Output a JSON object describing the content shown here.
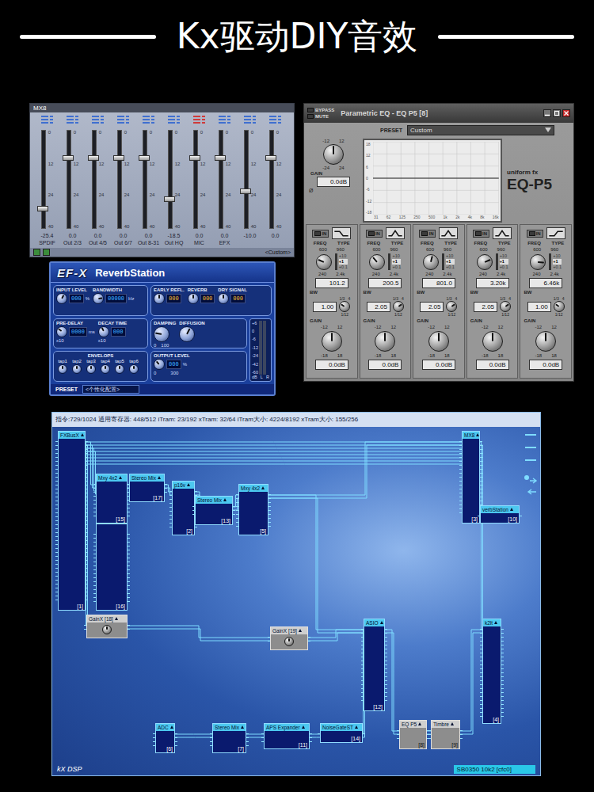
{
  "banner": {
    "title": "Kx驱动DIY音效"
  },
  "mixer": {
    "title": "MX8",
    "scale": [
      "0",
      "12",
      "24",
      "40"
    ],
    "preset": "<Custom>",
    "channels": [
      {
        "name": "SPDIF",
        "reading": "-25.4",
        "level": 0.2,
        "color": "#3f6fd0"
      },
      {
        "name": "Out 2/3",
        "reading": "0.0",
        "level": 0.72,
        "color": "#3f6fd0"
      },
      {
        "name": "Out 4/5",
        "reading": "0.0",
        "level": 0.72,
        "color": "#3f6fd0"
      },
      {
        "name": "Out 6/7",
        "reading": "0.0",
        "level": 0.72,
        "color": "#3f6fd0"
      },
      {
        "name": "Out 8-31",
        "reading": "0.0",
        "level": 0.72,
        "color": "#3f6fd0"
      },
      {
        "name": "Out HQ",
        "reading": "-18.5",
        "level": 0.3,
        "color": "#3f6fd0"
      },
      {
        "name": "MIC",
        "reading": "0.0",
        "level": 0.72,
        "color": "#d03a3a"
      },
      {
        "name": "EFX",
        "reading": "0.0",
        "level": 0.72,
        "color": "#3f6fd0"
      },
      {
        "name": "",
        "reading": "-10.0",
        "level": 0.38,
        "color": "#3f6fd0"
      },
      {
        "name": "",
        "reading": "0.0",
        "level": 0.72,
        "color": "#3f6fd0"
      }
    ]
  },
  "reverb": {
    "logo": "EF-X",
    "title": "ReverbStation",
    "input": [
      {
        "label": "INPUT LEVEL",
        "value": "000",
        "unit": "%",
        "level": 0.6
      },
      {
        "label": "BANDWIDTH",
        "value": "00000",
        "unit": "Hz",
        "level": 0.8
      }
    ],
    "levels": [
      {
        "label": "EARLY REFL.",
        "value": "000",
        "level": 0.5
      },
      {
        "label": "REVERB",
        "value": "000",
        "level": 0.5
      },
      {
        "label": "DRY SIGNAL",
        "value": "000",
        "level": 0.5
      }
    ],
    "delay": [
      {
        "label": "PRE-DELAY",
        "value": "0000",
        "unit": "ms",
        "mult": "x10",
        "level": 0.3
      },
      {
        "label": "DECAY TIME",
        "value": "000",
        "mult": "x10",
        "level": 0.4
      }
    ],
    "tone": [
      {
        "label": "DAMPING",
        "scale": [
          "0",
          "100"
        ],
        "level": 0.2
      },
      {
        "label": "DIFFUSION",
        "level": 0.6
      }
    ],
    "envelops": {
      "label": "ENVELOPS",
      "taps": [
        {
          "label": "tap1",
          "level": 0.5
        },
        {
          "label": "tap2",
          "level": 0.5
        },
        {
          "label": "tap3",
          "level": 0.5
        },
        {
          "label": "tap4",
          "level": 0.5
        },
        {
          "label": "tap5",
          "level": 0.5
        },
        {
          "label": "tap6",
          "level": 0.5
        }
      ]
    },
    "output": {
      "label": "OUTPUT LEVEL",
      "value": "000",
      "unit": "%",
      "scale": [
        "0",
        "300"
      ],
      "level": 0.35
    },
    "meter": {
      "scale": [
        "+6",
        "0",
        "-6",
        "-12",
        "-24",
        "-42",
        "-60"
      ],
      "unit": "dB",
      "channels": [
        {
          "name": "L",
          "level": 0
        },
        {
          "name": "R",
          "level": 0
        }
      ]
    },
    "preset": {
      "label": "PRESET",
      "value": "<个性化配置>"
    }
  },
  "eq": {
    "title": "Parametric EQ - EQ P5 [8]",
    "bypass": {
      "label": "BYPASS",
      "on": false
    },
    "mute": {
      "label": "MUTE",
      "on": false
    },
    "presetLabel": "PRESET",
    "preset": "Custom",
    "master": {
      "label": "GAIN",
      "value": "0.0dB",
      "level": 0.5,
      "scale": [
        "-12",
        "12",
        "-24",
        "24"
      ],
      "phase": "Ø"
    },
    "graph": {
      "x": [
        "31",
        "62",
        "125",
        "250",
        "500",
        "1k",
        "2k",
        "4k",
        "8k",
        "16k"
      ],
      "y": [
        "18",
        "12",
        "6",
        "0",
        "-6",
        "-12",
        "-18"
      ],
      "curve": [
        0,
        0,
        0,
        0,
        0,
        0,
        0,
        0,
        0,
        0
      ]
    },
    "brand": "uniform fx",
    "model": "EQ-P5",
    "labels": {
      "in": "IN",
      "type": "TYPE",
      "freq": "FREQ",
      "bw": "BW",
      "gain": "GAIN"
    },
    "freqScale": [
      "600",
      "960",
      "240",
      "2.4k"
    ],
    "range": [
      {
        "label": "+10",
        "selected": false
      },
      {
        "label": "+1",
        "selected": true
      },
      {
        "label": "+0.1",
        "selected": false
      }
    ],
    "bwScale": [
      "1/3",
      "4",
      "1/12"
    ],
    "gainScale": [
      "-12",
      "12",
      "-18",
      "18"
    ],
    "bands": [
      {
        "kind": "lowshelf",
        "on": false,
        "freq": "101.2",
        "freqLevel": 0.25,
        "bw": "1.00",
        "bwLevel": 0.3,
        "gain": "0.0dB",
        "gainLevel": 0.5
      },
      {
        "kind": "peak",
        "on": false,
        "freq": "200.5",
        "freqLevel": 0.35,
        "bw": "2.05",
        "bwLevel": 0.7,
        "gain": "0.0dB",
        "gainLevel": 0.5
      },
      {
        "kind": "peak",
        "on": false,
        "freq": "801.0",
        "freqLevel": 0.55,
        "bw": "2.05",
        "bwLevel": 0.7,
        "gain": "0.0dB",
        "gainLevel": 0.5
      },
      {
        "kind": "peak",
        "on": false,
        "freq": "3.20k",
        "freqLevel": 0.75,
        "bw": "2.05",
        "bwLevel": 0.7,
        "gain": "0.0dB",
        "gainLevel": 0.5
      },
      {
        "kind": "highshelf",
        "on": false,
        "freq": "6.46k",
        "freqLevel": 0.85,
        "bw": "1.00",
        "bwLevel": 0.3,
        "gain": "0.0dB",
        "gainLevel": 0.5
      }
    ]
  },
  "dsp": {
    "status": "指令:729/1024 通用寄存器: 448/512 iTram: 23/192 xTram: 32/64 iTram大小: 4224/8192 xTram大小: 155/256",
    "nodes": [
      {
        "name": "FXBusX",
        "id": "[1]",
        "kind": "module"
      },
      {
        "name": "Mxy 4x2",
        "id": "[15]",
        "kind": "module"
      },
      {
        "name": "",
        "id": "[16]",
        "kind": "module"
      },
      {
        "name": "Stereo Mix",
        "id": "[17]",
        "kind": "module"
      },
      {
        "name": "p16v",
        "id": "[2]",
        "kind": "module"
      },
      {
        "name": "Stereo Mix",
        "id": "[13]",
        "kind": "module"
      },
      {
        "name": "Mxy 4x2",
        "id": "[5]",
        "kind": "module"
      },
      {
        "name": "MX8",
        "id": "[3]",
        "kind": "module"
      },
      {
        "name": "verbStation",
        "id": "[10]",
        "kind": "module"
      },
      {
        "name": "GainX",
        "id": "[18]",
        "kind": "gain"
      },
      {
        "name": "GainX",
        "id": "[19]",
        "kind": "gain"
      },
      {
        "name": "ASIO",
        "id": "[12]",
        "kind": "module"
      },
      {
        "name": "k2lt",
        "id": "[4]",
        "kind": "module"
      },
      {
        "name": "ADC",
        "id": "[6]",
        "kind": "module"
      },
      {
        "name": "Stereo Mix",
        "id": "[7]",
        "kind": "module"
      },
      {
        "name": "APS Expander",
        "id": "[11]",
        "kind": "module"
      },
      {
        "name": "NoiseGateST",
        "id": "[14]",
        "kind": "module"
      },
      {
        "name": "EQ P5",
        "id": "[8]",
        "kind": "effect"
      },
      {
        "name": "Timbre",
        "id": "[9]",
        "kind": "effect"
      }
    ],
    "wires": [
      {
        "from": "[1]",
        "to": "[3]",
        "lines": 8
      },
      {
        "from": "[1]",
        "to": "[15]",
        "lines": 4
      },
      {
        "from": "[15]",
        "to": "[17]",
        "lines": 2
      },
      {
        "from": "[17]",
        "to": "[2]",
        "lines": 2
      },
      {
        "from": "[2]",
        "to": "[13]",
        "lines": 2
      },
      {
        "from": "[13]",
        "to": "[5]",
        "lines": 2
      },
      {
        "from": "[5]",
        "to": "[3]",
        "lines": 2
      },
      {
        "from": "[5]",
        "to": "[12]",
        "lines": 2
      },
      {
        "from": "[1]",
        "to": "[18]",
        "lines": 2
      },
      {
        "from": "[18]",
        "to": "[19]",
        "lines": 2
      },
      {
        "from": "[19]",
        "to": "[12]",
        "lines": 2
      },
      {
        "from": "[6]",
        "to": "[7]",
        "lines": 2
      },
      {
        "from": "[7]",
        "to": "[11]",
        "lines": 2
      },
      {
        "from": "[11]",
        "to": "[14]",
        "lines": 2
      },
      {
        "from": "[14]",
        "to": "[12]",
        "lines": 2
      },
      {
        "from": "[12]",
        "to": "[8]",
        "lines": 2
      },
      {
        "from": "[8]",
        "to": "[9]",
        "lines": 2
      },
      {
        "from": "[9]",
        "to": "[4]",
        "lines": 2
      },
      {
        "from": "[3]",
        "to": "[4]",
        "lines": 2
      }
    ],
    "footer": "kX DSP",
    "device": "SB0350 10k2 [cfc0]"
  }
}
